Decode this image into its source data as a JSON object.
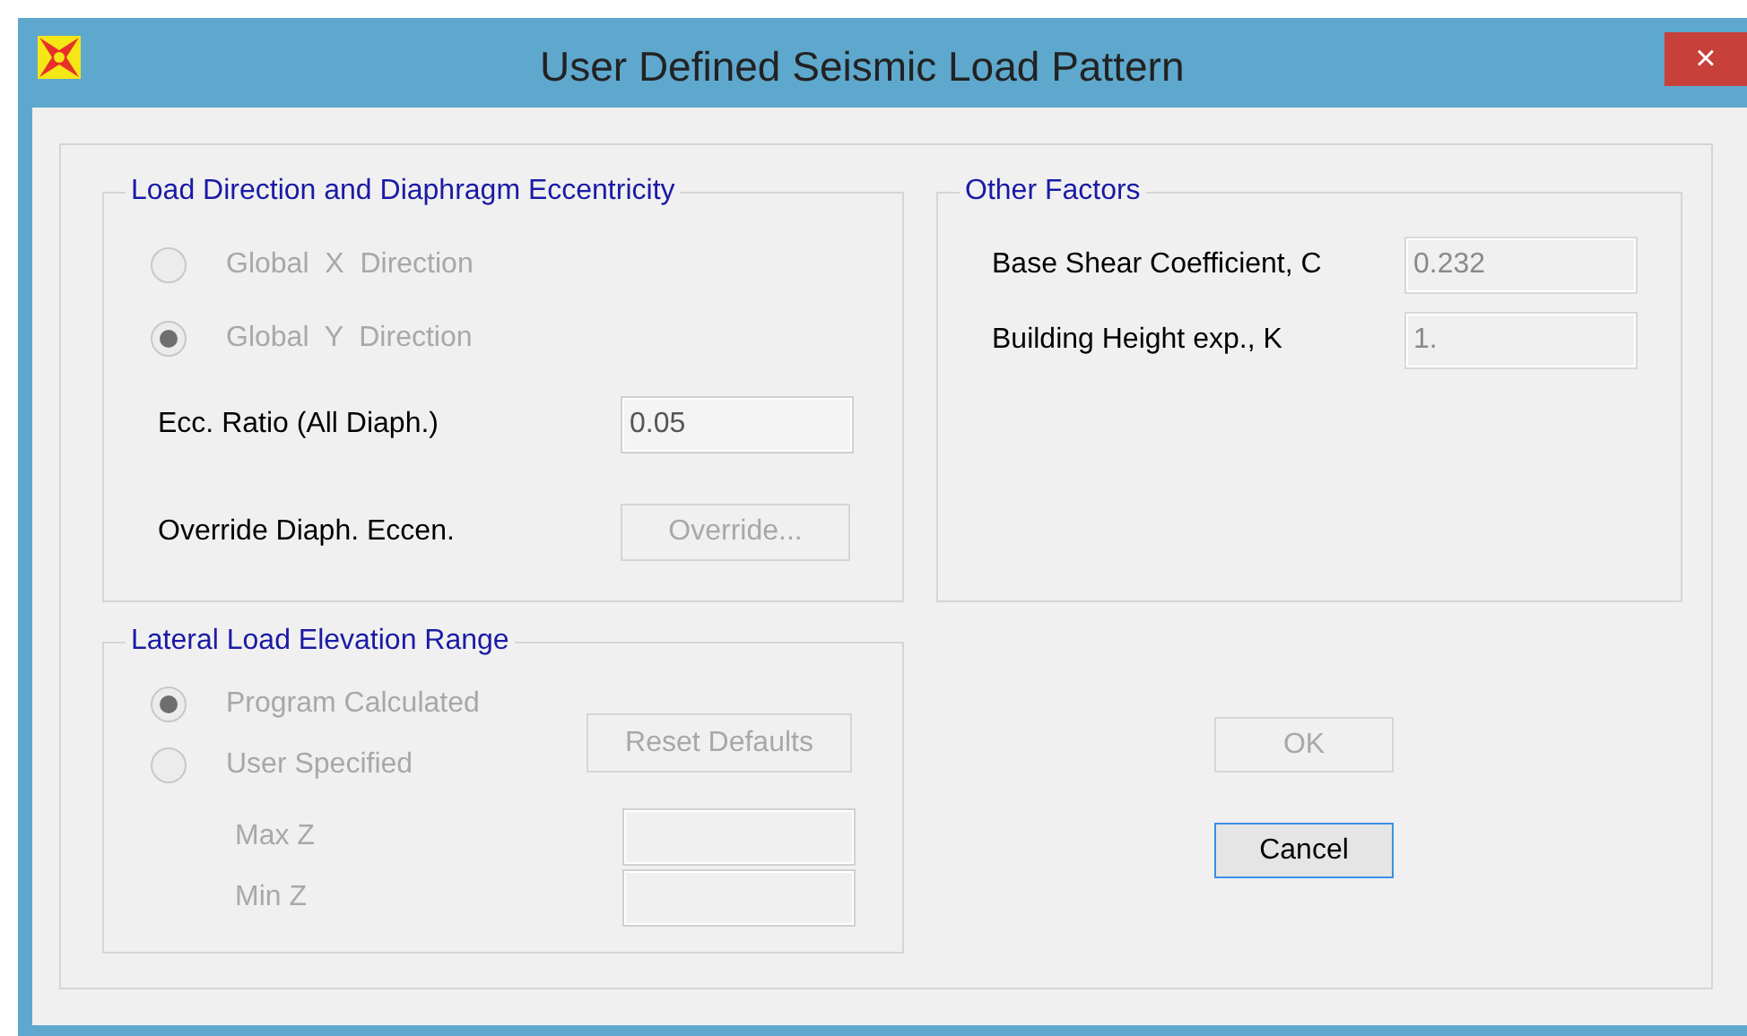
{
  "window": {
    "title": "User Defined Seismic Load Pattern",
    "close": "×"
  },
  "load_direction": {
    "title": "Load Direction and Diaphragm Eccentricity",
    "radios": [
      {
        "label": "Global  X  Direction",
        "selected": false,
        "disabled": true
      },
      {
        "label": "Global  Y  Direction",
        "selected": true,
        "disabled": true
      }
    ],
    "ecc_ratio": {
      "label": "Ecc. Ratio (All Diaph.)",
      "value": "0.05",
      "disabled": false
    },
    "override": {
      "label": "Override Diaph. Eccen.",
      "button": "Override...",
      "disabled": true
    }
  },
  "elevation_range": {
    "title": "Lateral Load Elevation Range",
    "radios": [
      {
        "label": "Program Calculated",
        "selected": true,
        "disabled": true
      },
      {
        "label": "User Specified",
        "selected": false,
        "disabled": true
      }
    ],
    "reset_button": {
      "label": "Reset Defaults",
      "disabled": true
    },
    "fields": [
      {
        "label": "Max Z",
        "disabled": true
      },
      {
        "label": "Min Z",
        "disabled": true
      }
    ]
  },
  "other_factors": {
    "title": "Other Factors",
    "fields": [
      {
        "label": "Base Shear Coefficient, C",
        "value": "0.232",
        "disabled": true
      },
      {
        "label": "Building Height exp., K",
        "value": "1.",
        "disabled": true
      }
    ]
  },
  "buttons": [
    {
      "label": "OK",
      "disabled": true,
      "default": false
    },
    {
      "label": "Cancel",
      "disabled": false,
      "default": true
    }
  ]
}
